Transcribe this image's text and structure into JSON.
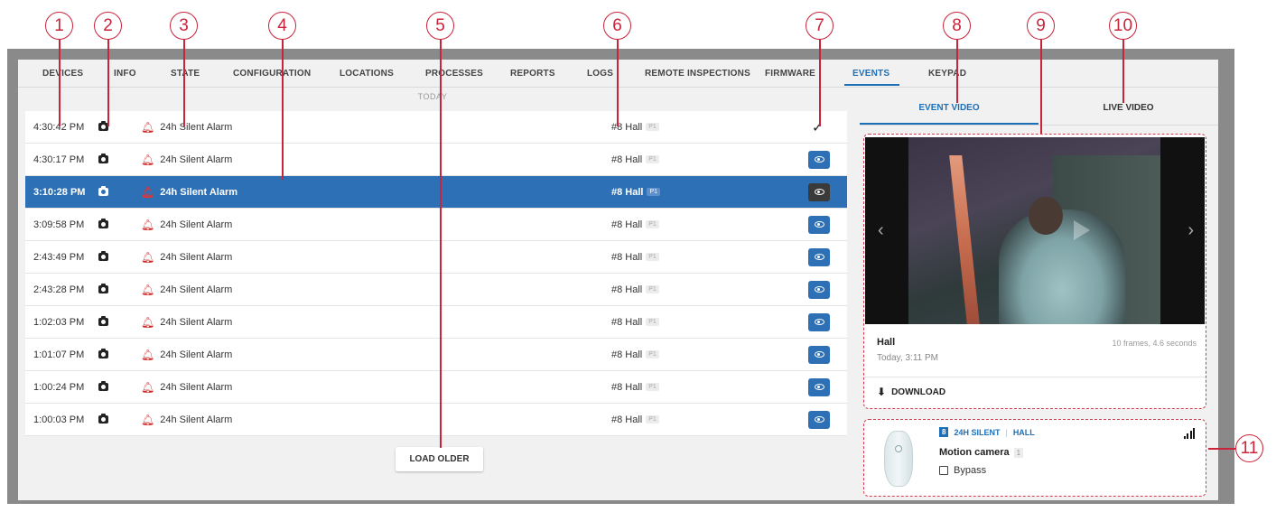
{
  "callouts": [
    "1",
    "2",
    "3",
    "4",
    "5",
    "6",
    "7",
    "8",
    "9",
    "10",
    "11"
  ],
  "nav": {
    "tabs": [
      "DEVICES",
      "INFO",
      "STATE",
      "CONFIGURATION",
      "LOCATIONS",
      "PROCESSES",
      "REPORTS",
      "LOGS",
      "REMOTE INSPECTIONS",
      "FIRMWARE",
      "EVENTS",
      "KEYPAD"
    ],
    "active": "EVENTS"
  },
  "list": {
    "header": "TODAY",
    "rows": [
      {
        "time": "4:30:42 PM",
        "alarm": "24h Silent Alarm",
        "zone": "#8 Hall",
        "p": "P1",
        "action": "check"
      },
      {
        "time": "4:30:17 PM",
        "alarm": "24h Silent Alarm",
        "zone": "#8 Hall",
        "p": "P1",
        "action": "view"
      },
      {
        "time": "3:10:28 PM",
        "alarm": "24h Silent Alarm",
        "zone": "#8 Hall",
        "p": "P1",
        "action": "view",
        "selected": true
      },
      {
        "time": "3:09:58 PM",
        "alarm": "24h Silent Alarm",
        "zone": "#8 Hall",
        "p": "P1",
        "action": "view"
      },
      {
        "time": "2:43:49 PM",
        "alarm": "24h Silent Alarm",
        "zone": "#8 Hall",
        "p": "P1",
        "action": "view"
      },
      {
        "time": "2:43:28 PM",
        "alarm": "24h Silent Alarm",
        "zone": "#8 Hall",
        "p": "P1",
        "action": "view"
      },
      {
        "time": "1:02:03 PM",
        "alarm": "24h Silent Alarm",
        "zone": "#8 Hall",
        "p": "P1",
        "action": "view"
      },
      {
        "time": "1:01:07 PM",
        "alarm": "24h Silent Alarm",
        "zone": "#8 Hall",
        "p": "P1",
        "action": "view"
      },
      {
        "time": "1:00:24 PM",
        "alarm": "24h Silent Alarm",
        "zone": "#8 Hall",
        "p": "P1",
        "action": "view"
      },
      {
        "time": "1:00:03 PM",
        "alarm": "24h Silent Alarm",
        "zone": "#8 Hall",
        "p": "P1",
        "action": "view"
      }
    ],
    "load_older": "LOAD OLDER"
  },
  "right": {
    "tabs": {
      "event_video": "EVENT VIDEO",
      "live_video": "LIVE VIDEO"
    },
    "video": {
      "title": "Hall",
      "subtitle": "Today, 3:11 PM",
      "frames": "10 frames, 4.6 seconds",
      "download": "DOWNLOAD"
    },
    "device": {
      "zone_number": "8",
      "type": "24H SILENT",
      "location": "HALL",
      "name": "Motion camera",
      "count": "1",
      "bypass": "Bypass"
    }
  },
  "colors": {
    "accent": "#1d6fb8",
    "selected_row": "#2e70b6",
    "callout": "#c8243a",
    "alarm_bell": "#cc2b2b"
  }
}
